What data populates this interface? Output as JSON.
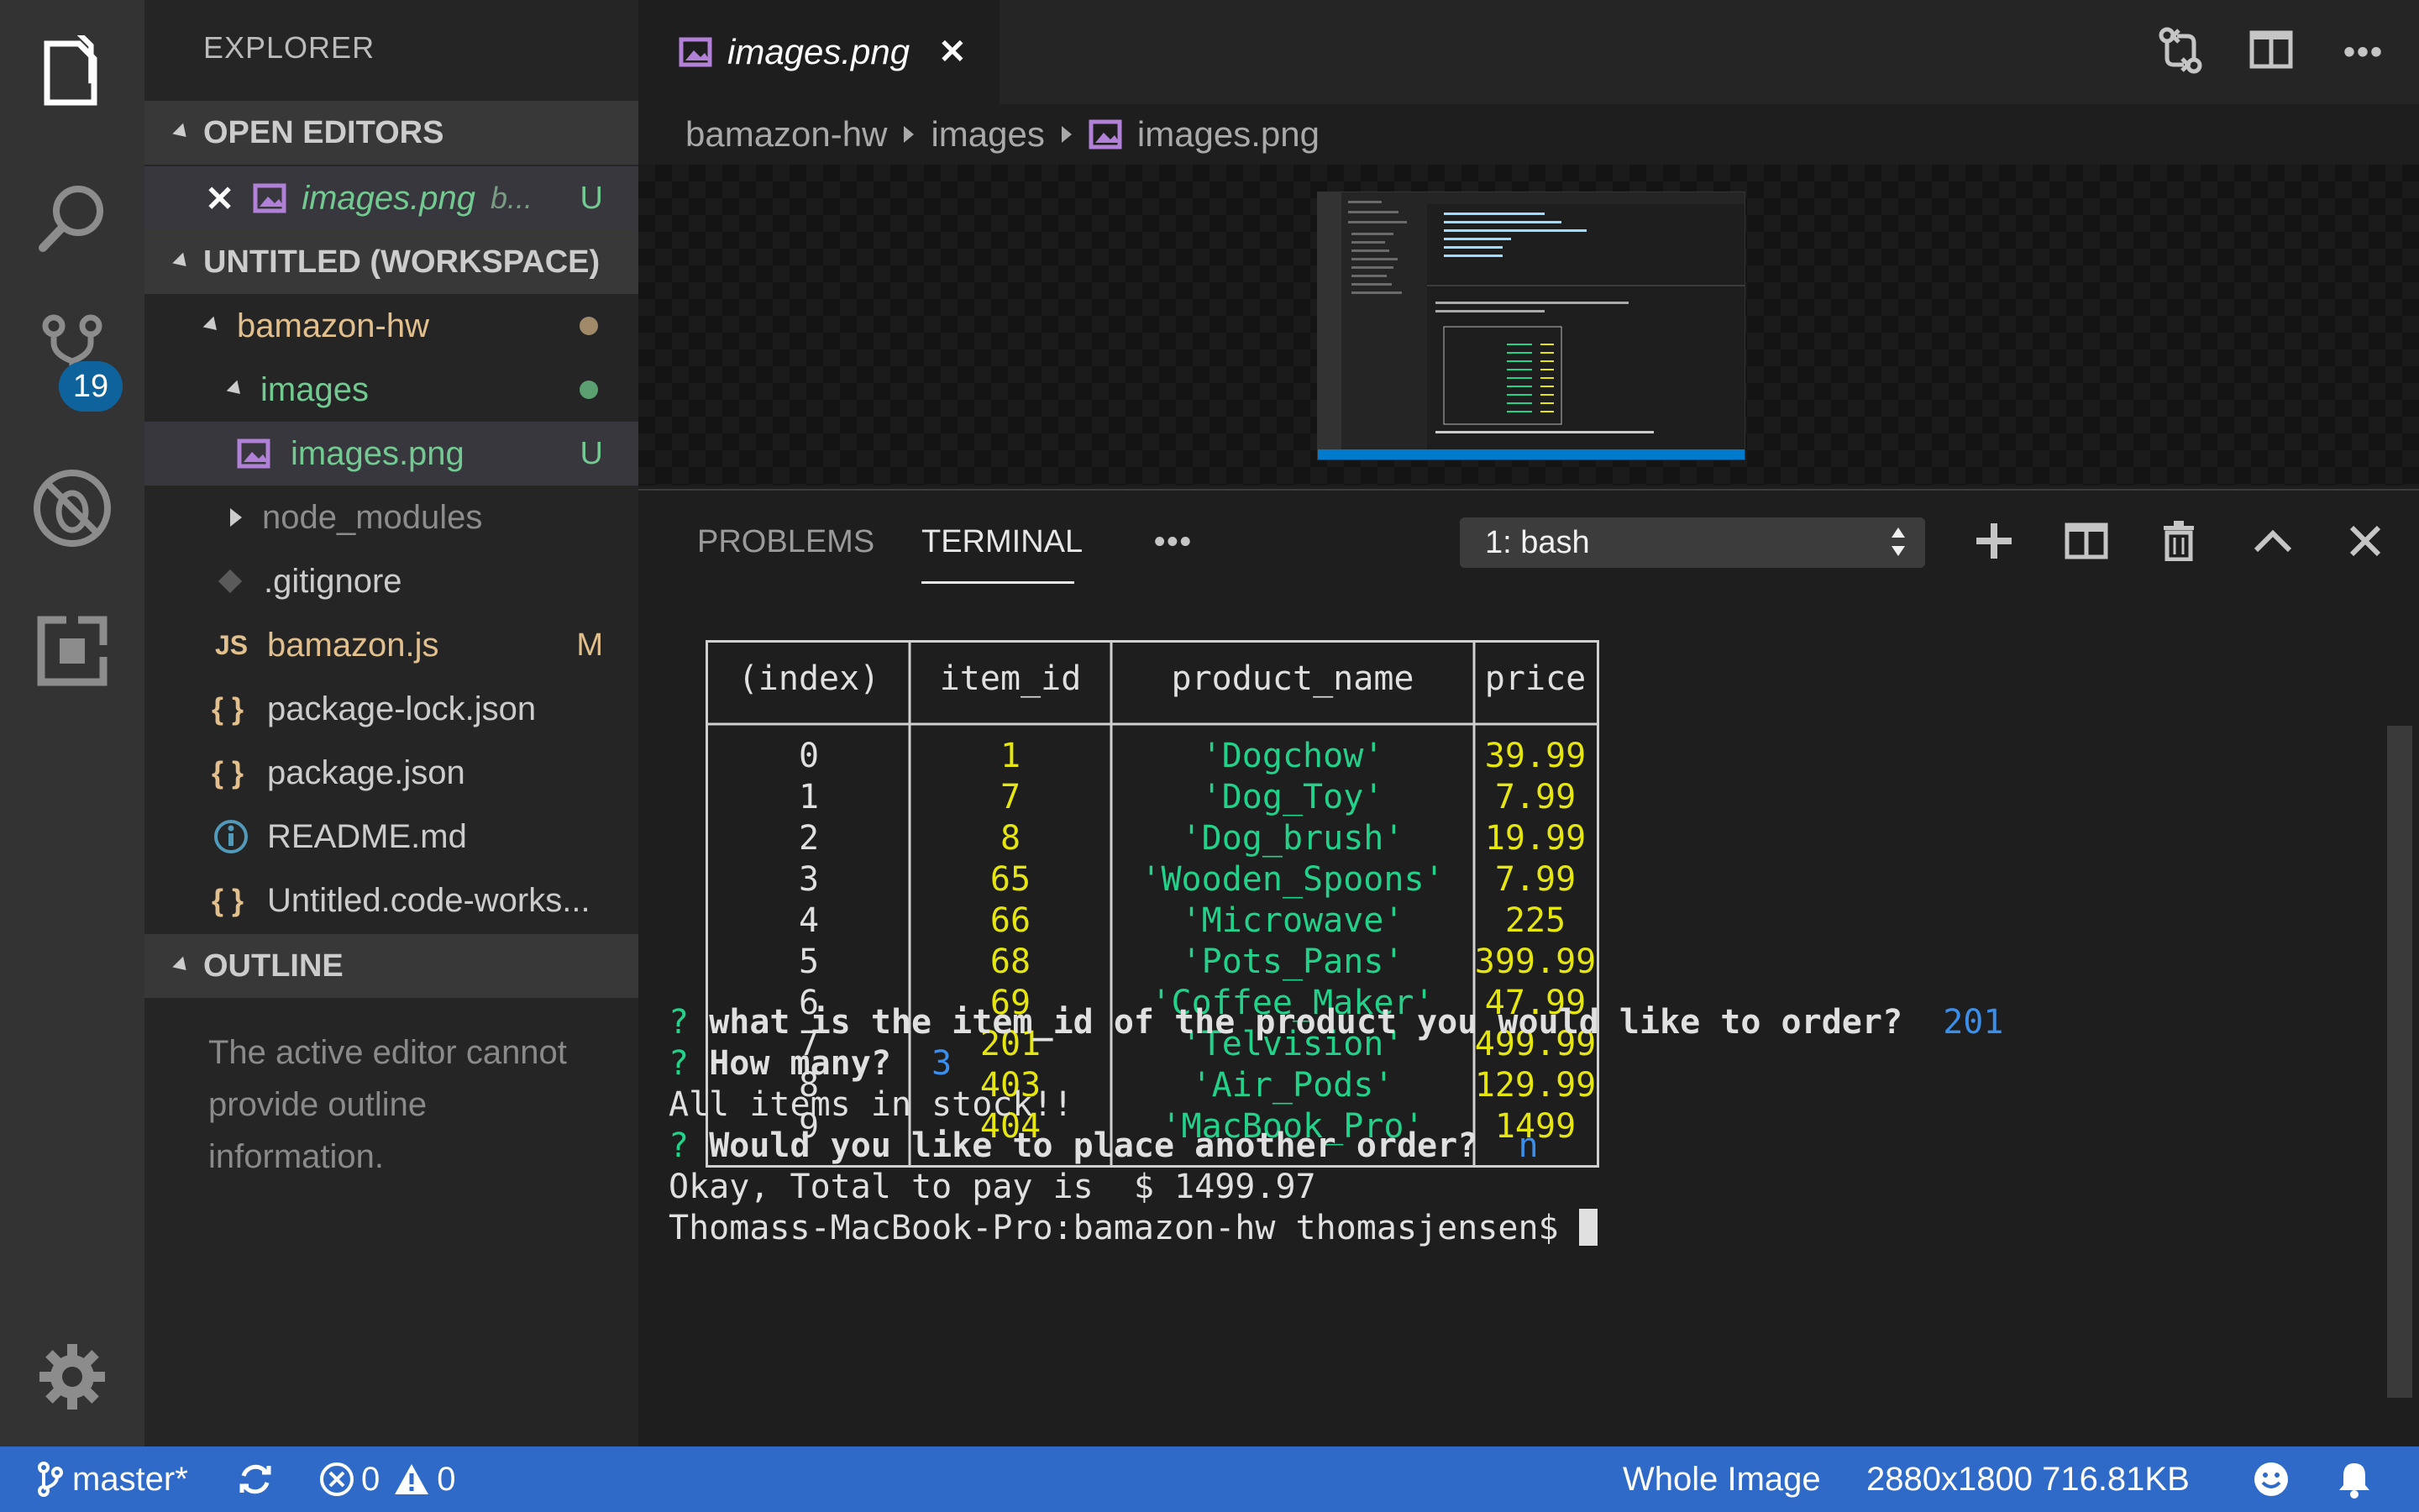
{
  "activity": {
    "source_control_badge": "19"
  },
  "sidebar": {
    "title": "EXPLORER",
    "open_editors": {
      "header": "OPEN EDITORS",
      "items": [
        {
          "label": "images.png",
          "detail": "b...",
          "status": "U"
        }
      ]
    },
    "workspace": {
      "header": "UNTITLED (WORKSPACE)",
      "items": [
        {
          "label": "bamazon-hw"
        },
        {
          "label": "images"
        },
        {
          "label": "images.png",
          "status": "U"
        },
        {
          "label": "node_modules"
        },
        {
          "label": ".gitignore"
        },
        {
          "label": "bamazon.js",
          "icon_text": "JS",
          "status": "M"
        },
        {
          "label": "package-lock.json",
          "icon_text": "{ }"
        },
        {
          "label": "package.json",
          "icon_text": "{ }"
        },
        {
          "label": "README.md"
        },
        {
          "label": "Untitled.code-works...",
          "icon_text": "{ }"
        }
      ]
    },
    "outline": {
      "header": "OUTLINE",
      "message": "The active editor cannot provide outline information."
    }
  },
  "editor": {
    "tab_label": "images.png",
    "breadcrumb": [
      "bamazon-hw",
      "images",
      "images.png"
    ]
  },
  "panel": {
    "tabs": [
      "PROBLEMS",
      "TERMINAL"
    ],
    "more": "•••",
    "terminal_select": "1: bash",
    "table": {
      "headers": [
        "(index)",
        "item_id",
        "product_name",
        "price"
      ],
      "rows": [
        [
          "0",
          "1",
          "'Dogchow'",
          "39.99"
        ],
        [
          "1",
          "7",
          "'Dog_Toy'",
          "7.99"
        ],
        [
          "2",
          "8",
          "'Dog_brush'",
          "19.99"
        ],
        [
          "3",
          "65",
          "'Wooden_Spoons'",
          "7.99"
        ],
        [
          "4",
          "66",
          "'Microwave'",
          "225"
        ],
        [
          "5",
          "68",
          "'Pots_Pans'",
          "399.99"
        ],
        [
          "6",
          "69",
          "'Coffee_Maker'",
          "47.99"
        ],
        [
          "7",
          "201",
          "'Telvision'",
          "499.99"
        ],
        [
          "8",
          "403",
          "'Air_Pods'",
          "129.99"
        ],
        [
          "9",
          "404",
          "'MacBook_Pro'",
          "1499"
        ]
      ]
    },
    "lines": {
      "q1_mark": "?",
      "q1_text": "what is the item_id of the product you would like to order?",
      "q1_answer": "201",
      "q2_mark": "?",
      "q2_text": "How many?",
      "q2_answer": "3",
      "stock": "All items in stock!!",
      "q3_mark": "?",
      "q3_text": "Would you like to place another order?",
      "q3_answer": "n",
      "total": "Okay, Total to pay is  $ 1499.97",
      "prompt": "Thomass-MacBook-Pro:bamazon-hw thomasjensen$"
    }
  },
  "status": {
    "branch": "master*",
    "errors": "0",
    "warnings": "0",
    "image_mode": "Whole Image",
    "image_info": "2880x1800 716.81KB"
  },
  "colors": {
    "accent_blue": "#2f6ac9",
    "git_untracked": "#73c991",
    "git_modified": "#e2c08d",
    "term_yellow": "#e5e510",
    "term_green": "#23d18b",
    "term_cyan": "#3b8eea"
  }
}
